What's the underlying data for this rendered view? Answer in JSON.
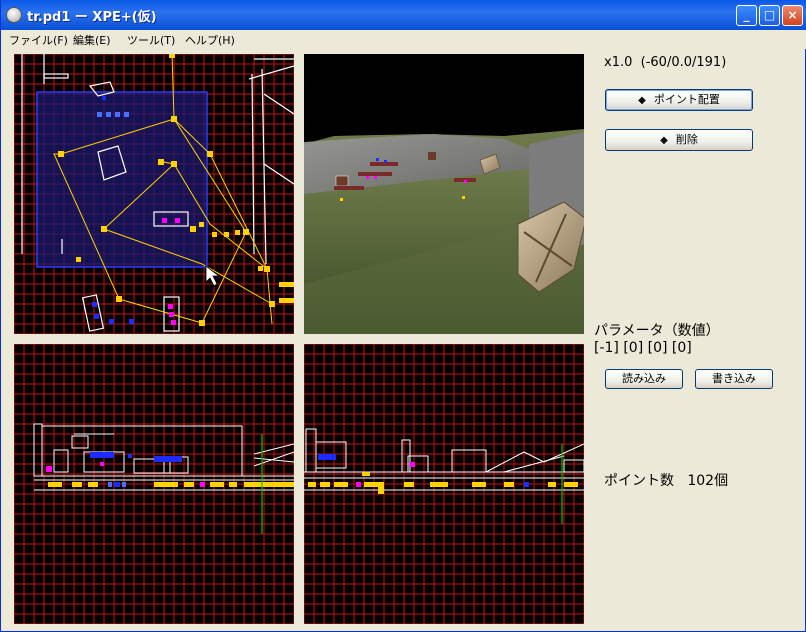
{
  "window": {
    "title": "tr.pd1 ー XPE+(仮)"
  },
  "titlebar": {
    "minimize": "_",
    "maximize": "□",
    "close": "×"
  },
  "menu": [
    "ファイル(F)",
    "編集(E)",
    "ツール(T)",
    "ヘルプ(H)"
  ],
  "side": {
    "zoom": "x1.0",
    "coords": "(-60/0.0/191)",
    "buttons": {
      "place_point": "ポイント配置",
      "delete": "削除",
      "icon": "◆"
    },
    "param_label": "パラメータ（数値）",
    "param_values": "[-1] [0] [0] [0]",
    "load": "読み込み",
    "save": "書き込み",
    "point_count_label": "ポイント数",
    "point_count_value": "102個"
  },
  "colors": {
    "grid_red": "#c81010",
    "path_yellow": "#ffd200",
    "marker_blue": "#1a2cff",
    "marker_magenta": "#ff00ff",
    "guide_green": "#00c800"
  },
  "icons": {
    "app": "globe-icon",
    "cursor": "mouse-cursor-icon"
  }
}
